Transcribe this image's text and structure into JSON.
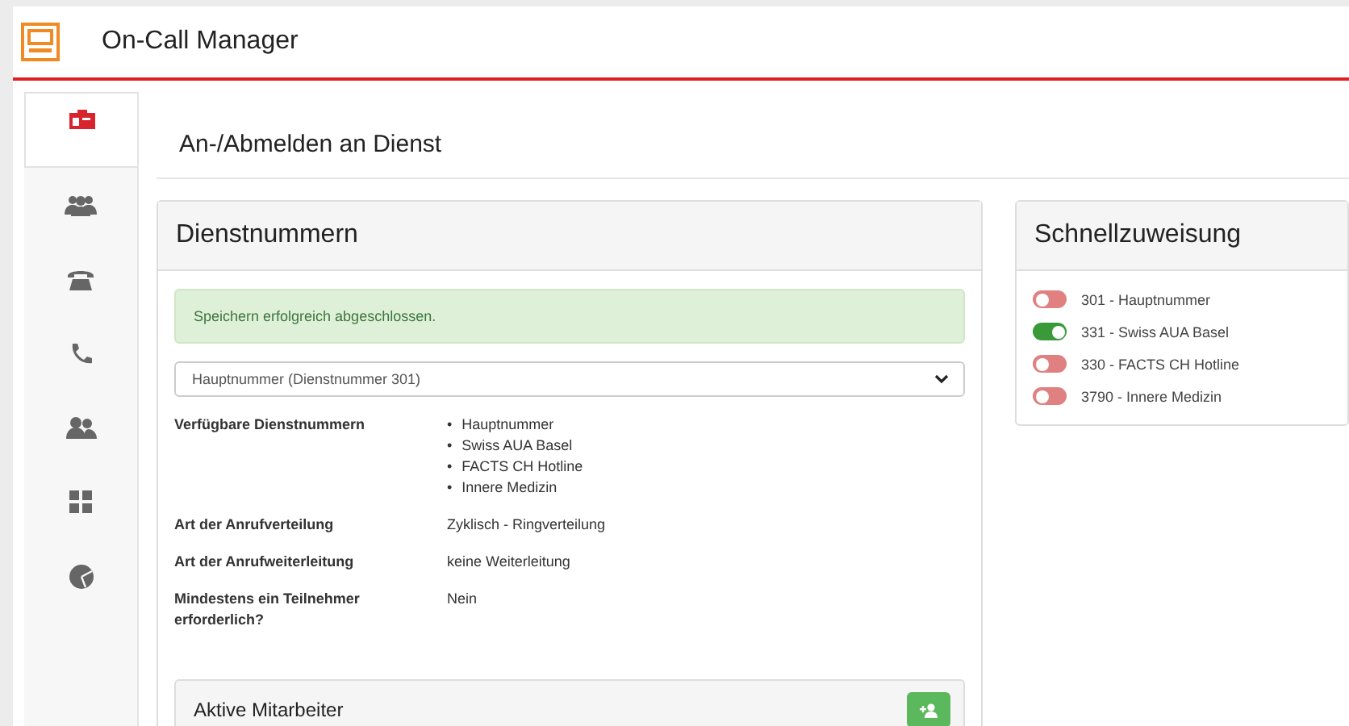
{
  "app": {
    "title": "On-Call Manager"
  },
  "sidebar": {
    "items": [
      {
        "kind": "badge",
        "selected": true
      },
      {
        "kind": "group",
        "selected": false
      },
      {
        "kind": "phone",
        "selected": false
      },
      {
        "kind": "handset",
        "selected": false
      },
      {
        "kind": "users",
        "selected": false
      },
      {
        "kind": "grid",
        "selected": false
      },
      {
        "kind": "pie",
        "selected": false
      }
    ]
  },
  "page_title": "An-/Abmelden an Dienst",
  "service_panel": {
    "title": "Dienstnummern",
    "alert": "Speichern erfolgreich abgeschlossen.",
    "select": {
      "value": "Hauptnummer (Dienstnummer 301)"
    },
    "details": [
      {
        "label": "Verfügbare Dienstnummern",
        "bullet": "•",
        "list": [
          "Hauptnummer",
          "Swiss AUA Basel",
          "FACTS CH Hotline",
          "Innere Medizin"
        ]
      },
      {
        "label": "Art der Anrufverteilung",
        "value": "Zyklisch - Ringverteilung"
      },
      {
        "label": "Art der Anrufweiterleitung",
        "value": "keine Weiterleitung"
      },
      {
        "label": "Mindestens ein Teilnehmer erforderlich?",
        "value": "Nein"
      }
    ],
    "active_staff": {
      "title": "Aktive Mitarbeiter"
    }
  },
  "quick_panel": {
    "title": "Schnellzuweisung",
    "items": [
      {
        "label": "301 - Hauptnummer",
        "on": false
      },
      {
        "label": "331 - Swiss AUA Basel",
        "on": true
      },
      {
        "label": "330 - FACTS CH Hotline",
        "on": false
      },
      {
        "label": "3790 - Innere Medizin",
        "on": false
      }
    ]
  }
}
